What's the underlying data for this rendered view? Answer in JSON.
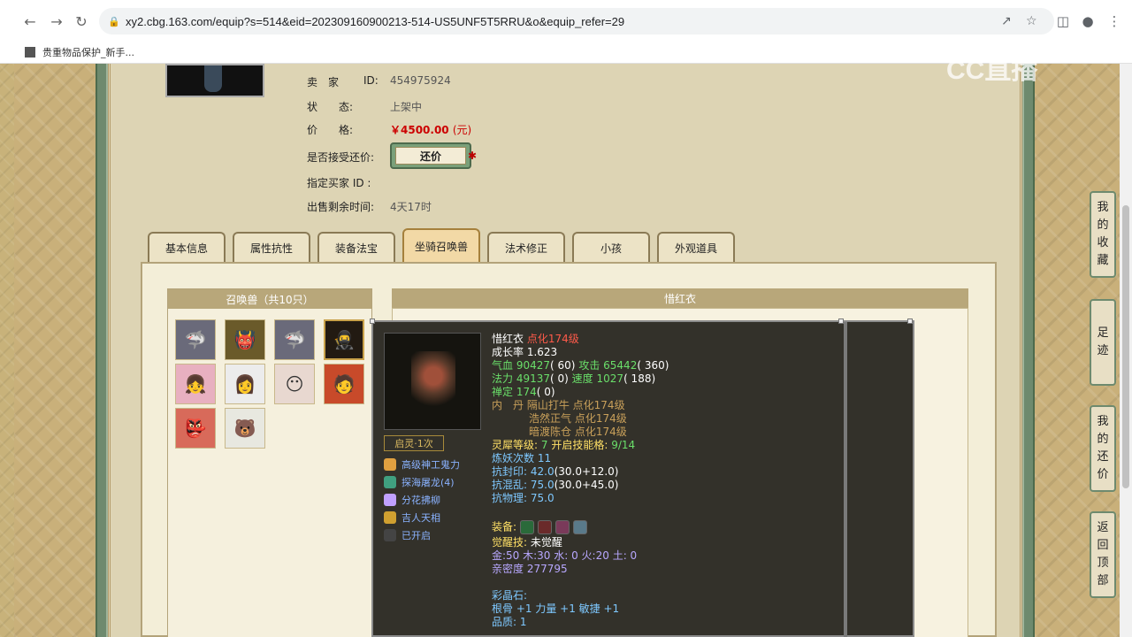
{
  "browser": {
    "url": "xy2.cbg.163.com/equip?s=514&eid=202309160900213-514-US5UNF5T5RRU&o&equip_refer=29",
    "bookmark": "贵重物品保护_新手..."
  },
  "watermark": "CC直播",
  "seller": {
    "seller_label": "卖　家",
    "id_label": "ID:",
    "id_value": "454975924",
    "status_label": "状　　态:",
    "status_value": "上架中",
    "price_label": "价　　格:",
    "price_value": "￥4500.00",
    "price_unit": "(元)",
    "accept_label": "是否接受还价:",
    "haggle_button": "还价",
    "buyer_label": "指定买家 ID :",
    "time_label": "出售剩余时间:",
    "time_value": "4天17时"
  },
  "tabs": [
    {
      "label": "基本信息"
    },
    {
      "label": "属性抗性"
    },
    {
      "label": "装备法宝"
    },
    {
      "label": "坐骑召唤兽"
    },
    {
      "label": "法术修正"
    },
    {
      "label": "小孩"
    },
    {
      "label": "外观道具"
    }
  ],
  "pets": {
    "header": "召唤兽（共10只）",
    "selected_index": 3,
    "icons": [
      "shark",
      "goblin",
      "shark",
      "warrior",
      "girl",
      "lady",
      "mask",
      "hero",
      "demon",
      "bear"
    ]
  },
  "detail": {
    "header": "惜红衣"
  },
  "tooltip": {
    "name": "惜红衣",
    "upgrade": "点化174级",
    "growth": "成长率 1.623",
    "hp_label": "气血",
    "hp_value": "90427",
    "hp_extra": "( 60)",
    "atk_label": "攻击",
    "atk_value": "65442",
    "atk_extra": "( 360)",
    "mp_label": "法力",
    "mp_value": "49137",
    "mp_extra": "( 0)",
    "spd_label": "速度",
    "spd_value": "1027",
    "spd_extra": "( 188)",
    "chan_label": "禅定",
    "chan_value": "174",
    "chan_extra": "( 0)",
    "inner_label": "内　丹",
    "inner1": "隔山打牛 点化174级",
    "inner2": "浩然正气 点化174级",
    "inner3": "暗渡陈仓 点化174级",
    "soul_label": "灵犀等级:",
    "soul_value": "7",
    "skill_slot_label": "开启技能格:",
    "skill_slot_value": "9/14",
    "refine_label": "炼妖次数",
    "refine_value": "11",
    "seal_label": "抗封印:",
    "seal_value": "42.0",
    "seal_detail": "(30.0+12.0)",
    "chaos_label": "抗混乱:",
    "chaos_value": "75.0",
    "chaos_detail": "(30.0+45.0)",
    "phys_label": "抗物理:",
    "phys_value": "75.0",
    "equip_label": "装备:",
    "awake_label": "觉醒技:",
    "awake_value": "未觉醒",
    "elements": "金:50 木:30 水: 0 火:20 土: 0",
    "intimacy": "亲密度 277795",
    "crystal_label": "彩晶石:",
    "crystal_value": "根骨 +1 力量 +1 敏捷 +1",
    "quality": "品质: 1",
    "awaken_badge": "启灵·1次",
    "skills": [
      {
        "label": "高级神工鬼力",
        "color": "#e0a040"
      },
      {
        "label": "探海屠龙(4)",
        "color": "#40a080"
      },
      {
        "label": "分花拂柳",
        "color": "#c0a0ff"
      },
      {
        "label": "吉人天相",
        "color": "#d0a030"
      },
      {
        "label": "已开启",
        "color": "#444444"
      }
    ]
  },
  "float_tools": {
    "fav": [
      "我",
      "的",
      "收",
      "藏"
    ],
    "foot": [
      "足",
      "迹"
    ],
    "haggle": [
      "我",
      "的",
      "还",
      "价"
    ],
    "top": [
      "返",
      "回",
      "顶",
      "部"
    ]
  }
}
